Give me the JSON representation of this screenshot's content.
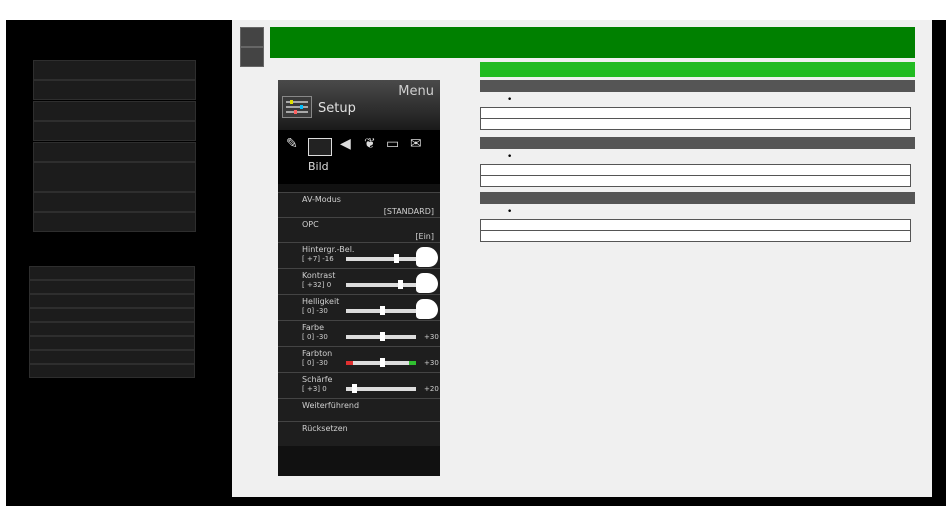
{
  "tv_menu": {
    "header_title": "Menu",
    "section_title": "Setup",
    "selected_tab": "Bild",
    "items": [
      {
        "label": "AV-Modus",
        "value": "[STANDARD]"
      },
      {
        "label": "OPC",
        "value": "[Ein]"
      },
      {
        "label": "Hintergr.-Bel.",
        "setting": "[  +7]",
        "min": "-16",
        "max": ""
      },
      {
        "label": "Kontrast",
        "setting": "[ +32]",
        "min": "0",
        "max": ""
      },
      {
        "label": "Helligkeit",
        "setting": "[   0]",
        "min": "-30",
        "max": ""
      },
      {
        "label": "Farbe",
        "setting": "[   0]",
        "min": "-30",
        "max": "+30"
      },
      {
        "label": "Farbton",
        "setting": "[   0]",
        "min": "-30",
        "max": "+30"
      },
      {
        "label": "Schärfe",
        "setting": "[  +3]",
        "min": "0",
        "max": "+20"
      },
      {
        "label": "Weiterführend"
      },
      {
        "label": "Rücksetzen"
      }
    ]
  },
  "colors": {
    "header_green": "#008000",
    "section_green": "#22bb22",
    "section_gray": "#555555"
  },
  "article": {
    "bullets": [
      "•",
      "•",
      "•"
    ]
  }
}
